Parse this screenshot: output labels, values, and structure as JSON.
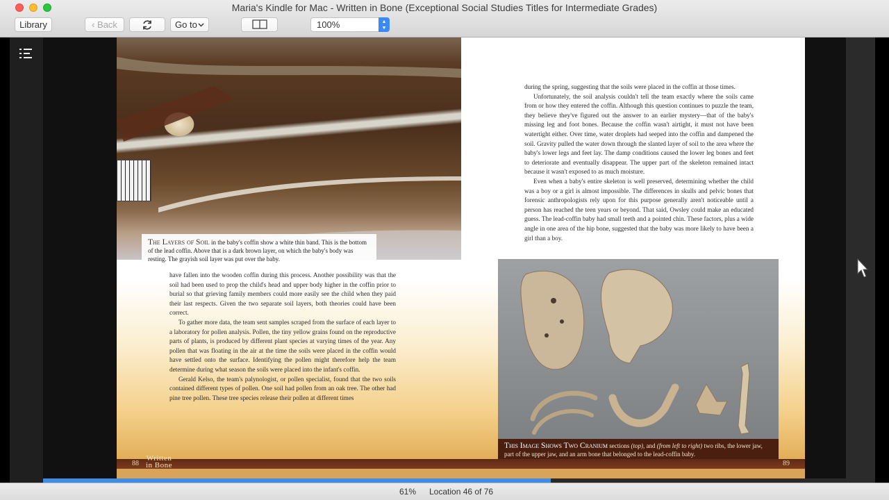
{
  "window": {
    "title": "Maria's Kindle for Mac - Written in Bone (Exceptional Social Studies Titles for Intermediate Grades)"
  },
  "toolbar": {
    "library_label": "Library",
    "back_label": "‹ Back",
    "sync_icon": "refresh-icon",
    "goto_label": "Go to",
    "view_icon": "two-column-view-icon",
    "zoom_value": "100%"
  },
  "left_page": {
    "caption_head": "The Layers of Soil",
    "caption_text": " in the baby's coffin show a white thin band. This is the bottom of the lead coffin. Above that is a dark brown layer, on which the baby's body was resting. The grayish soil layer was put over the baby.",
    "paragraphs": [
      "have fallen into the wooden coffin during this process. Another possibility was that the soil had been used to prop the child's head and upper body higher in the coffin prior to burial so that grieving family members could more easily see the child when they paid their last respects. Given the two separate soil layers, both theories could have been correct.",
      "To gather more data, the team sent samples scraped from the surface of each layer to a laboratory for pollen analysis. Pollen, the tiny yellow grains found on the reproductive parts of plants, is produced by different plant species at varying times of the year. Any pollen that was floating in the air at the time the soils were placed in the coffin would have settled onto the surface. Identifying the pollen might therefore help the team determine during what season the soils were placed into the infant's coffin.",
      "Gerald Kelso, the team's palynologist, or pollen specialist, found that the two soils contained different types of pollen. One soil had pollen from an oak tree. The other had pine tree pollen. These tree species release their pollen at different times"
    ],
    "folio": "88",
    "logo_line1": "Written",
    "logo_line2": "in Bone"
  },
  "right_page": {
    "paragraphs": [
      "during the spring, suggesting that the soils were placed in the coffin at those times.",
      "Unfortunately, the soil analysis couldn't tell the team exactly where the soils came from or how they entered the coffin. Although this question continues to puzzle the team, they believe they've figured out the answer to an earlier mystery—that of the baby's missing leg and foot bones. Because the coffin wasn't airtight, it must not have been watertight either. Over time, water droplets had seeped into the coffin and dampened the soil. Gravity pulled the water down through the slanted layer of soil to the area where the baby's lower legs and feet lay. The damp conditions caused the lower leg bones and feet to deteriorate and eventually disappear. The upper part of the skeleton remained intact because it wasn't exposed to as much moisture.",
      "Even when a baby's entire skeleton is well preserved, determining whether the child was a boy or a girl is almost impossible. The differences in skulls and pelvic bones that forensic anthropologists rely upon for this purpose generally aren't noticeable until a person has reached the teen years or beyond. That said, Owsley could make an educated guess. The lead-coffin baby had small teeth and a pointed chin. These factors, plus a wide angle in one area of the hip bone, suggested that the baby was more likely to have been a girl than a boy."
    ],
    "caption_head": "This Image Shows Two Cranium",
    "caption_text_1": " sections ",
    "caption_em_1": "(top)",
    "caption_text_2": ", and ",
    "caption_em_2": "(from left to right)",
    "caption_text_3": " two ribs, the lower jaw, part of the upper jaw, and an arm bone that belonged to the lead-coffin baby.",
    "folio": "89"
  },
  "status": {
    "progress": 61,
    "percent_label": "61%",
    "location_label": "Location 46 of 76"
  },
  "colors": {
    "progress_fill": "#3b8de8",
    "caption_dark": "#4a1f10"
  }
}
